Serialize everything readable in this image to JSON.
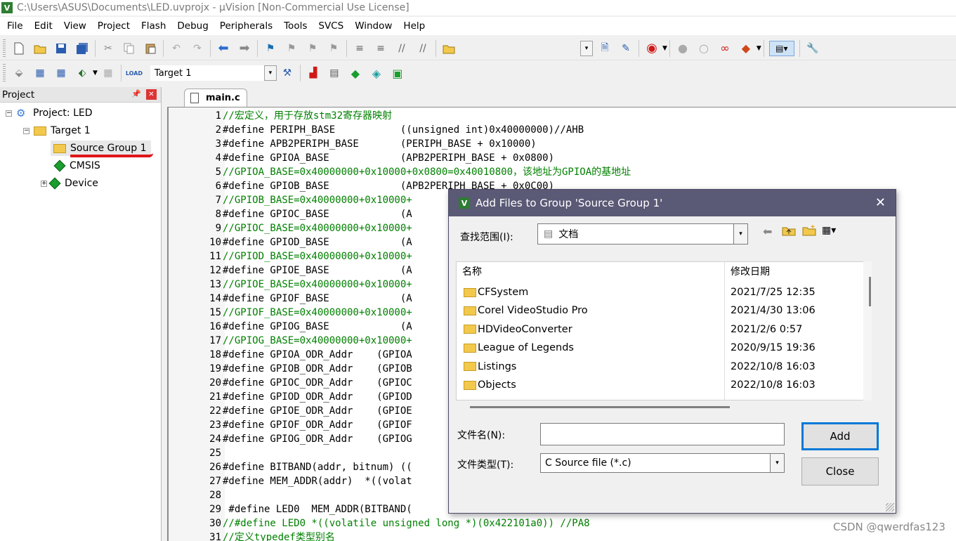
{
  "window": {
    "title": "C:\\Users\\ASUS\\Documents\\LED.uvprojx - µVision  [Non-Commercial Use License]"
  },
  "menu": [
    "File",
    "Edit",
    "View",
    "Project",
    "Flash",
    "Debug",
    "Peripherals",
    "Tools",
    "SVCS",
    "Window",
    "Help"
  ],
  "toolbar2": {
    "target": "Target 1"
  },
  "project_panel": {
    "title": "Project",
    "tree": [
      {
        "label": "Project: LED",
        "toggle": "−"
      },
      {
        "label": "Target 1",
        "toggle": "−"
      },
      {
        "label": "Source Group 1"
      },
      {
        "label": "CMSIS"
      },
      {
        "label": "Device",
        "toggle": "+"
      }
    ]
  },
  "editor": {
    "tab": "main.c",
    "lines": [
      {
        "n": "1",
        "text": "//宏定义，用于存放stm32寄存器映射",
        "comment": true
      },
      {
        "n": "2",
        "text": "#define PERIPH_BASE           ((unsigned int)0x40000000)//AHB",
        "comment": false
      },
      {
        "n": "3",
        "text": "#define APB2PERIPH_BASE       (PERIPH_BASE + 0x10000)",
        "comment": false
      },
      {
        "n": "4",
        "text": "#define GPIOA_BASE            (APB2PERIPH_BASE + 0x0800)",
        "comment": false
      },
      {
        "n": "5",
        "text": "//GPIOA_BASE=0x40000000+0x10000+0x0800=0x40010800，该地址为GPIOA的基地址",
        "comment": true
      },
      {
        "n": "6",
        "text": "#define GPIOB_BASE            (APB2PERIPH_BASE + 0x0C00)",
        "comment": false
      },
      {
        "n": "7",
        "text": "//GPIOB_BASE=0x40000000+0x10000+",
        "comment": true
      },
      {
        "n": "8",
        "text": "#define GPIOC_BASE            (A",
        "comment": false
      },
      {
        "n": "9",
        "text": "//GPIOC_BASE=0x40000000+0x10000+",
        "comment": true
      },
      {
        "n": "10",
        "text": "#define GPIOD_BASE            (A",
        "comment": false
      },
      {
        "n": "11",
        "text": "//GPIOD_BASE=0x40000000+0x10000+",
        "comment": true
      },
      {
        "n": "12",
        "text": "#define GPIOE_BASE            (A",
        "comment": false
      },
      {
        "n": "13",
        "text": "//GPIOE_BASE=0x40000000+0x10000+",
        "comment": true
      },
      {
        "n": "14",
        "text": "#define GPIOF_BASE            (A",
        "comment": false
      },
      {
        "n": "15",
        "text": "//GPIOF_BASE=0x40000000+0x10000+",
        "comment": true
      },
      {
        "n": "16",
        "text": "#define GPIOG_BASE            (A",
        "comment": false
      },
      {
        "n": "17",
        "text": "//GPIOG_BASE=0x40000000+0x10000+",
        "comment": true
      },
      {
        "n": "18",
        "text": "#define GPIOA_ODR_Addr    (GPIOA",
        "comment": false
      },
      {
        "n": "19",
        "text": "#define GPIOB_ODR_Addr    (GPIOB",
        "comment": false
      },
      {
        "n": "20",
        "text": "#define GPIOC_ODR_Addr    (GPIOC",
        "comment": false
      },
      {
        "n": "21",
        "text": "#define GPIOD_ODR_Addr    (GPIOD",
        "comment": false
      },
      {
        "n": "22",
        "text": "#define GPIOE_ODR_Addr    (GPIOE",
        "comment": false
      },
      {
        "n": "23",
        "text": "#define GPIOF_ODR_Addr    (GPIOF",
        "comment": false
      },
      {
        "n": "24",
        "text": "#define GPIOG_ODR_Addr    (GPIOG",
        "comment": false
      },
      {
        "n": "25",
        "text": "",
        "comment": false
      },
      {
        "n": "26",
        "text": "#define BITBAND(addr, bitnum) ((",
        "comment": false
      },
      {
        "n": "27",
        "text": "#define MEM_ADDR(addr)  *((volat",
        "comment": false
      },
      {
        "n": "28",
        "text": "",
        "comment": false
      },
      {
        "n": "29",
        "text": " #define LED0  MEM_ADDR(BITBAND(",
        "comment": false
      },
      {
        "n": "30",
        "text": "//#define LED0 *((volatile unsigned long *)(0x422101a0)) //PA8",
        "comment": true
      },
      {
        "n": "31",
        "text": "//定义typedef类型别名",
        "comment": true
      }
    ]
  },
  "dialog": {
    "title": "Add Files to Group 'Source Group 1'",
    "look_in_label": "查找范围(I):",
    "look_in_value": "文档",
    "col_name": "名称",
    "col_date": "修改日期",
    "files": [
      {
        "name": "CFSystem",
        "date": "2021/7/25 12:35"
      },
      {
        "name": "Corel VideoStudio Pro",
        "date": "2021/4/30 13:06"
      },
      {
        "name": "HDVideoConverter",
        "date": "2021/2/6 0:57"
      },
      {
        "name": "League of Legends",
        "date": "2020/9/15 19:36"
      },
      {
        "name": "Listings",
        "date": "2022/10/8 16:03"
      },
      {
        "name": "Objects",
        "date": "2022/10/8 16:03"
      }
    ],
    "filename_label": "文件名(N):",
    "filename_value": "",
    "filetype_label": "文件类型(T):",
    "filetype_value": "C Source file (*.c)",
    "add_label": "Add",
    "close_label": "Close"
  },
  "watermark": "CSDN @qwerdfas123"
}
